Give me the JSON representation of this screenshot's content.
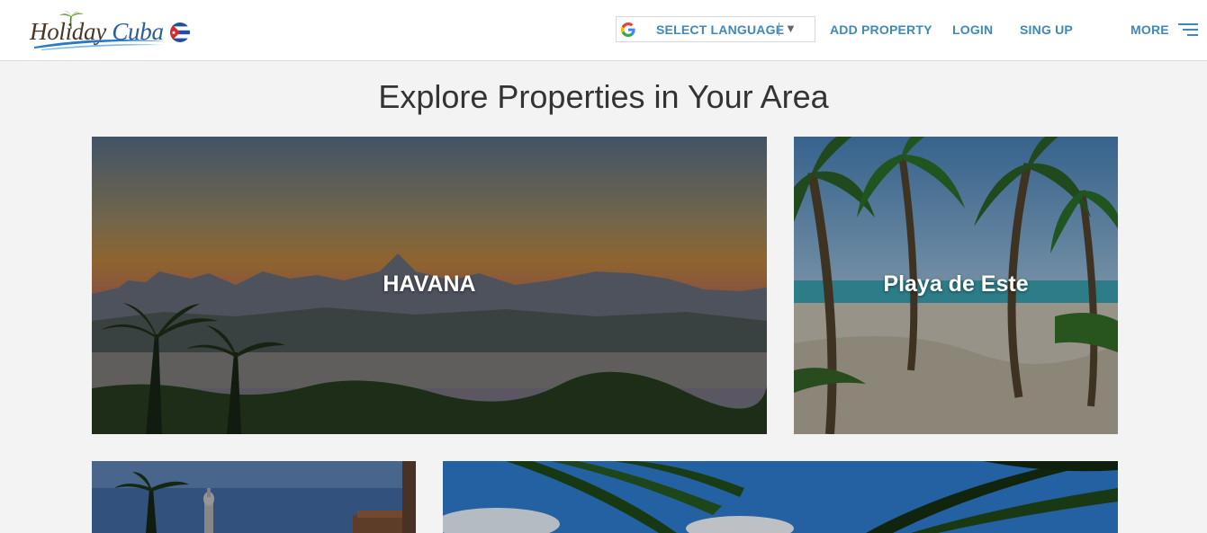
{
  "brand": {
    "logo_text_part1": "Holiday",
    "logo_text_part2": "Cuba"
  },
  "header": {
    "language_selector": {
      "label": "SELECT LANGUAGE",
      "caret": "▼"
    },
    "nav": {
      "add_property": "ADD PROPERTY",
      "login": "LOGIN",
      "signup": "SING UP",
      "more": "MORE"
    }
  },
  "main": {
    "title": "Explore Properties in Your Area",
    "destinations": [
      {
        "label": "HAVANA"
      },
      {
        "label": "Playa de Este"
      },
      {
        "label": ""
      },
      {
        "label": ""
      }
    ]
  },
  "icons": {
    "google": "google-icon",
    "menu": "hamburger-menu-icon",
    "flag": "cuba-flag-icon",
    "palm": "palm-tree-icon"
  },
  "colors": {
    "accent": "#3f88b8",
    "header_bg": "#ffffff",
    "page_bg": "#f3f3f3",
    "title_text": "#333333"
  }
}
